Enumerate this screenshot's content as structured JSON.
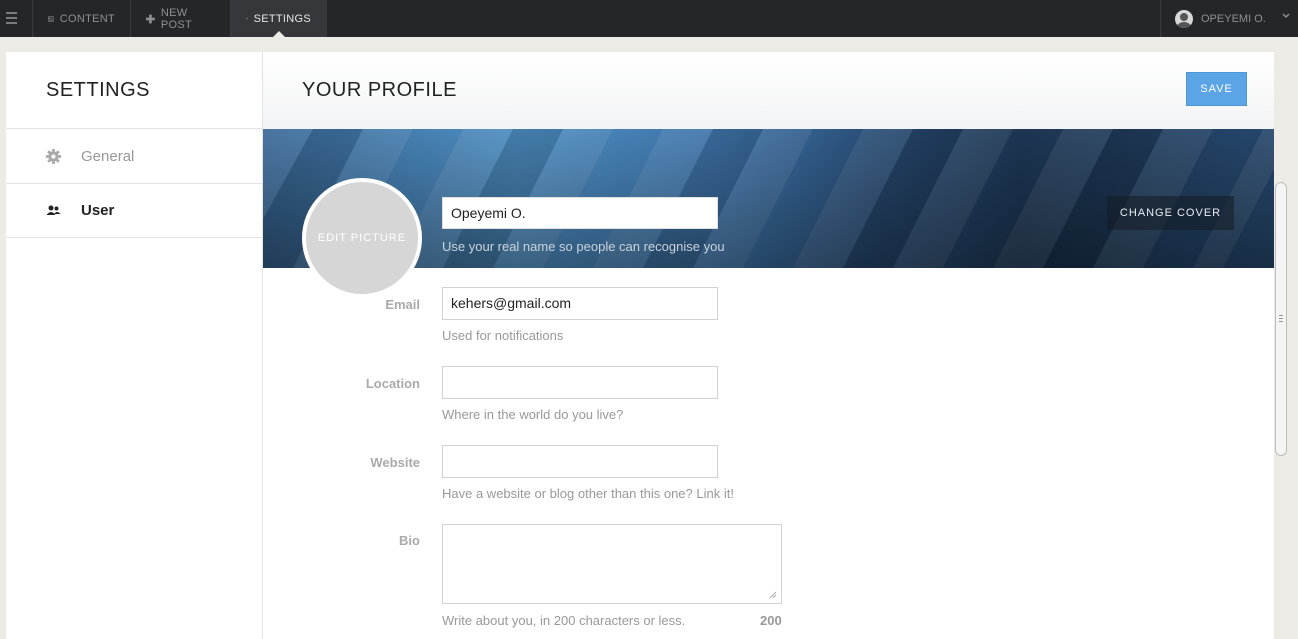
{
  "nav": {
    "content": "CONTENT",
    "new_post": "NEW POST",
    "settings": "SETTINGS",
    "user_name": "OPEYEMI O."
  },
  "sidebar": {
    "title": "SETTINGS",
    "items": [
      {
        "label": "General",
        "icon": "gear-icon"
      },
      {
        "label": "User",
        "icon": "users-icon"
      }
    ]
  },
  "profile": {
    "title": "YOUR PROFILE",
    "save_label": "SAVE",
    "change_cover_label": "CHANGE COVER",
    "edit_picture_label": "EDIT PICTURE",
    "name_value": "Opeyemi O.",
    "name_help": "Use your real name so people can recognise you",
    "email_label": "Email",
    "email_value": "kehers@gmail.com",
    "email_help": "Used for notifications",
    "location_label": "Location",
    "location_value": "",
    "location_help": "Where in the world do you live?",
    "website_label": "Website",
    "website_value": "",
    "website_help": "Have a website or blog other than this one? Link it!",
    "bio_label": "Bio",
    "bio_value": "",
    "bio_help": "Write about you, in 200 characters or less.",
    "bio_count": "200"
  },
  "colors": {
    "topbar": "#242628",
    "save_button": "#5ba4e5",
    "page_bg": "#ecebe6"
  }
}
